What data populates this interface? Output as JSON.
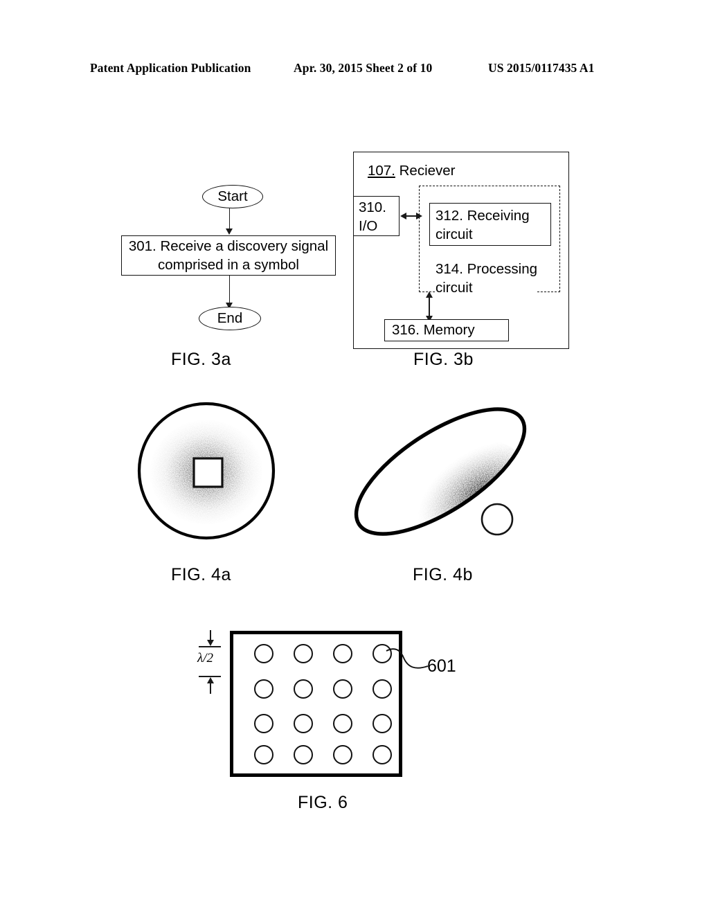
{
  "header": {
    "left": "Patent Application Publication",
    "middle": "Apr. 30, 2015  Sheet 2 of 10",
    "right": "US 2015/0117435 A1"
  },
  "colors": {
    "ink": "#111111",
    "paper": "#ffffff",
    "stipple": "#222222"
  },
  "figures": {
    "fig3a": {
      "caption": "FIG. 3a",
      "nodes": {
        "start": "Start",
        "step_301": "301. Receive a discovery signal comprised in a symbol",
        "step_301_line1": "301. Receive a discovery signal",
        "step_301_line2": "comprised in a symbol",
        "end": "End"
      }
    },
    "fig3b": {
      "caption": "FIG. 3b",
      "blocks": {
        "receiver_num": "107.",
        "receiver_name": "Reciever",
        "io_line1": "310.",
        "io_line2": "I/O",
        "receiving_line1": "312. Receiving",
        "receiving_line2": "circuit",
        "processing_line1": "314. Processing",
        "processing_line2": "circuit",
        "memory": "316. Memory"
      }
    },
    "fig4a": {
      "caption": "FIG. 4a"
    },
    "fig4b": {
      "caption": "FIG. 4b"
    },
    "fig6": {
      "caption": "FIG. 6",
      "spacing_label": "λ/2",
      "reference_label": "601",
      "array_rows": 4,
      "array_cols": 4
    }
  }
}
